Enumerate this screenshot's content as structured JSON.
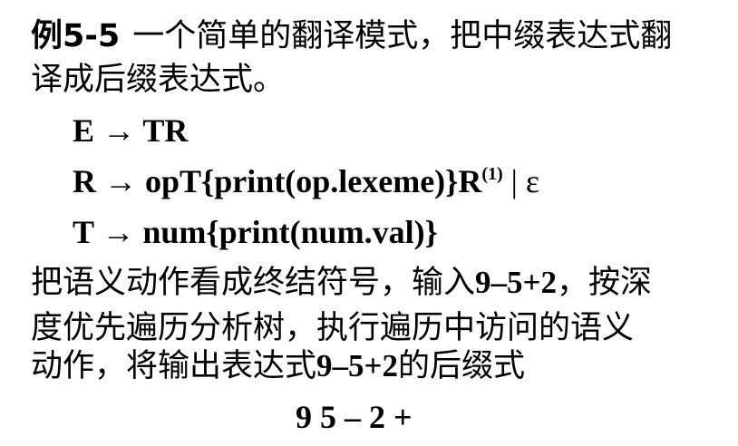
{
  "example": {
    "number": "例5-5",
    "title_part1": "一个简单的翻译模式，把中缀表达式翻",
    "title_part2": "译成后缀表达式。"
  },
  "productions": [
    {
      "lhs": "E",
      "arrow": "→",
      "rhs": "TR"
    },
    {
      "lhs": "R",
      "arrow": "→",
      "rhs": "opT{print(op.lexeme)}R",
      "sup": "(1)",
      "alt": "| ε"
    },
    {
      "lhs": "T",
      "arrow": "→",
      "rhs": "num{print(num.val)}"
    }
  ],
  "explanation": {
    "line1_a": "把语义动作看成终结符号，输入",
    "line1_input": "9–5+2",
    "line1_b": "，按深",
    "line2": "度优先遍历分析树，执行遍历中访问的语义",
    "line3_a": "动作，将输出表达式",
    "line3_expr": "9–5+2",
    "line3_b": "的后缀式"
  },
  "result": "9 5 – 2 +"
}
